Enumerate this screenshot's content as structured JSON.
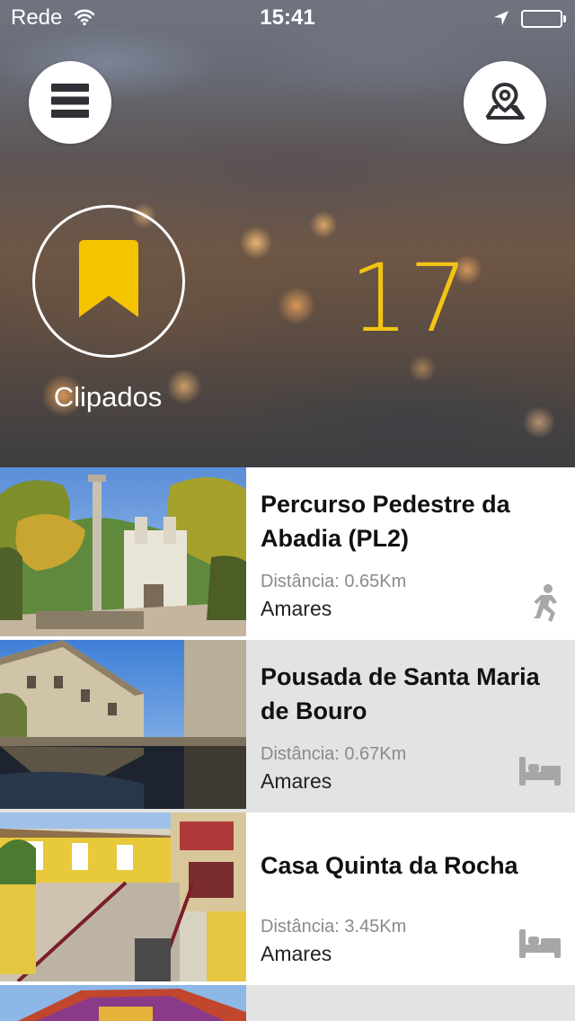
{
  "status_bar": {
    "carrier": "Rede",
    "time": "15:41",
    "icons": [
      "wifi-icon",
      "location-arrow-icon",
      "battery-icon"
    ]
  },
  "header": {
    "menu_icon": "menu-icon",
    "map_icon": "map-pin-icon"
  },
  "clipped": {
    "icon": "bookmark-icon",
    "label": "Clipados",
    "count": "17",
    "accent_color": "#f2c414"
  },
  "items": [
    {
      "title": "Percurso Pedestre da Abadia (PL2)",
      "distance": "Distância: 0.65Km",
      "location": "Amares",
      "category_icon": "hiker-icon"
    },
    {
      "title": "Pousada de Santa Maria de Bouro",
      "distance": "Distância: 0.67Km",
      "location": "Amares",
      "category_icon": "bed-icon"
    },
    {
      "title": "Casa Quinta da Rocha",
      "distance": "Distância: 3.45Km",
      "location": "Amares",
      "category_icon": "bed-icon"
    }
  ]
}
